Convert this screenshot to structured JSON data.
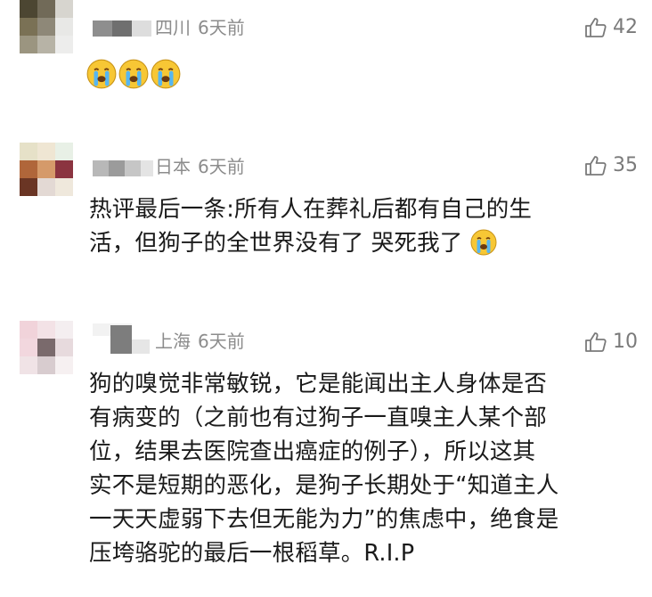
{
  "comments": [
    {
      "location": "四川",
      "time": "6天前",
      "likes": "42",
      "text": "",
      "emoji_count": 3,
      "emoji": "crying-face-icon"
    },
    {
      "location": "日本",
      "time": "6天前",
      "likes": "35",
      "text_line1": "热评最后一条:所有人在葬礼后都有自己的生",
      "text_line2": "活，但狗子的全世界没有了   哭死我了",
      "emoji": "crying-face-icon"
    },
    {
      "location": "上海",
      "time": "6天前",
      "likes": "10",
      "lines": [
        "狗的嗅觉非常敏锐，它是能闻出主人身体是否",
        "有病变的（之前也有过狗子一直嗅主人某个部",
        "位，结果去医院查出癌症的例子），所以这其",
        "实不是短期的恶化，是狗子长期处于“知道主人",
        "一天天虚弱下去但无能为力”的焦虑中，绝食是",
        "压垮骆驼的最后一根稻草。R.I.P"
      ]
    }
  ],
  "colors": {
    "meta": "#8c8c8c",
    "text": "#1a1a1a",
    "like": "#7a7a7a"
  }
}
